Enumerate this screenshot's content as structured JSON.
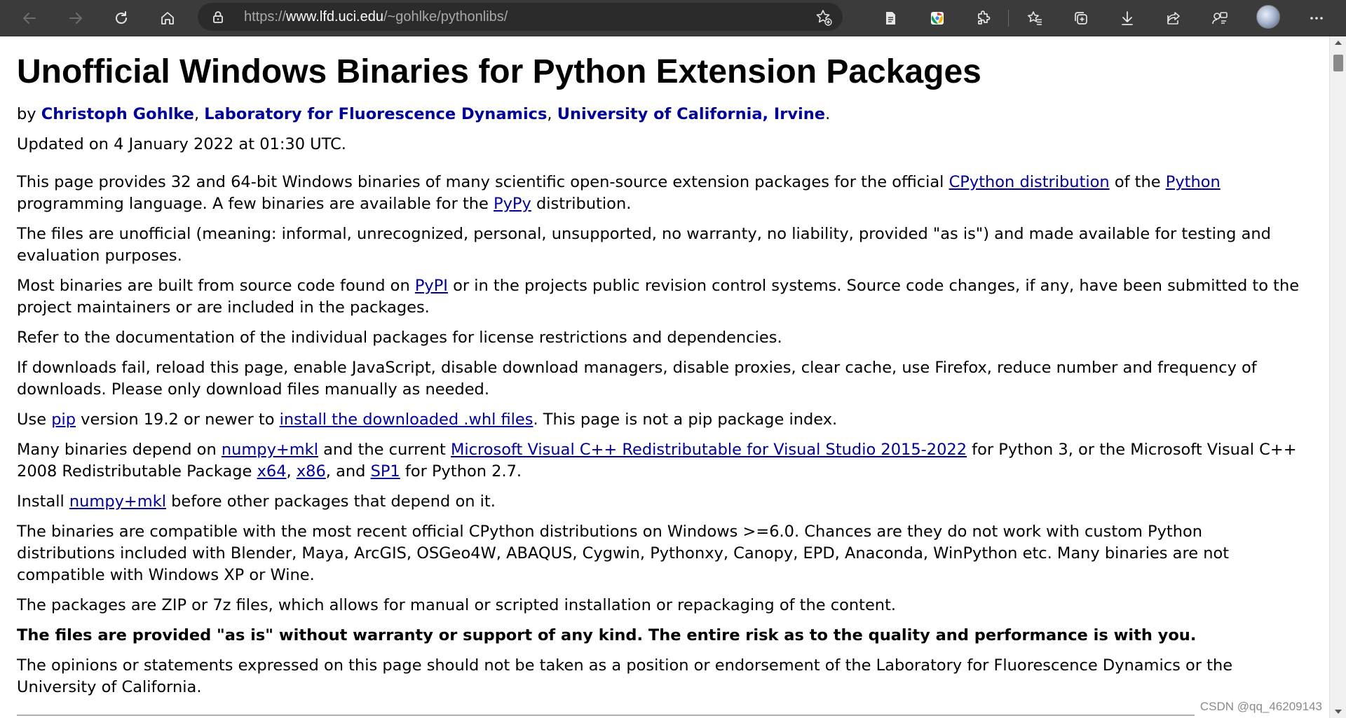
{
  "browser": {
    "url_prefix": "https://",
    "url_domain": "www.lfd.uci.edu",
    "url_path": "/~gohlke/pythonlibs/",
    "icons": [
      "back-icon",
      "forward-icon",
      "refresh-icon",
      "home-icon",
      "lock-icon",
      "add-favorite-icon",
      "reading-view-icon",
      "extension-icon",
      "puzzle-icon",
      "favorites-icon",
      "collections-icon",
      "download-icon",
      "share-icon",
      "feedback-icon",
      "avatar",
      "more-icon"
    ]
  },
  "page": {
    "title": "Unofficial Windows Binaries for Python Extension Packages",
    "byline": {
      "by": "by ",
      "author": "Christoph Gohlke",
      "sep1": ", ",
      "lab": "Laboratory for Fluorescence Dynamics",
      "sep2": ", ",
      "univ": "University of California, Irvine",
      "end": "."
    },
    "updated": "Updated on 4 January 2022 at 01:30 UTC.",
    "p1": {
      "t1": "This page provides 32 and 64-bit Windows binaries of many scientific open-source extension packages for the official ",
      "l1": "CPython distribution",
      "t2": " of the ",
      "l2": "Python",
      "t3": " programming language. A few binaries are available for the ",
      "l3": "PyPy",
      "t4": " distribution."
    },
    "p2": "The files are unofficial (meaning: informal, unrecognized, personal, unsupported, no warranty, no liability, provided \"as is\") and made available for testing and evaluation purposes.",
    "p3": {
      "t1": "Most binaries are built from source code found on ",
      "l1": "PyPI",
      "t2": " or in the projects public revision control systems. Source code changes, if any, have been submitted to the project maintainers or are included in the packages."
    },
    "p4": "Refer to the documentation of the individual packages for license restrictions and dependencies.",
    "p5": "If downloads fail, reload this page, enable JavaScript, disable download managers, disable proxies, clear cache, use Firefox, reduce number and frequency of downloads. Please only download files manually as needed.",
    "p6": {
      "t1": "Use ",
      "l1": "pip",
      "t2": " version 19.2 or newer to ",
      "l2": "install the downloaded .whl files",
      "t3": ". This page is not a pip package index."
    },
    "p7": {
      "t1": "Many binaries depend on ",
      "l1": "numpy+mkl",
      "t2": " and the current ",
      "l2": "Microsoft Visual C++ Redistributable for Visual Studio 2015-2022",
      "t3": " for Python 3, or the Microsoft Visual C++ 2008 Redistributable Package ",
      "l3": "x64",
      "t4": ", ",
      "l4": "x86",
      "t5": ", and ",
      "l5": "SP1",
      "t6": " for Python 2.7."
    },
    "p8": {
      "t1": "Install ",
      "l1": "numpy+mkl",
      "t2": " before other packages that depend on it."
    },
    "p9": "The binaries are compatible with the most recent official CPython distributions on Windows >=6.0. Chances are they do not work with custom Python distributions included with Blender, Maya, ArcGIS, OSGeo4W, ABAQUS, Cygwin, Pythonxy, Canopy, EPD, Anaconda, WinPython etc. Many binaries are not compatible with Windows XP or Wine.",
    "p10": "The packages are ZIP or 7z files, which allows for manual or scripted installation or repackaging of the content.",
    "p11": "The files are provided \"as is\" without warranty or support of any kind. The entire risk as to the quality and performance is with you.",
    "p12": "The opinions or statements expressed on this page should not be taken as a position or endorsement of the Laboratory for Fluorescence Dynamics or the University of California."
  },
  "watermark": "CSDN @qq_46209143",
  "colors": {
    "toolbar": "#3b3b3b",
    "address_bar": "#2b2b2b",
    "link": "#000099",
    "text": "#000000"
  }
}
